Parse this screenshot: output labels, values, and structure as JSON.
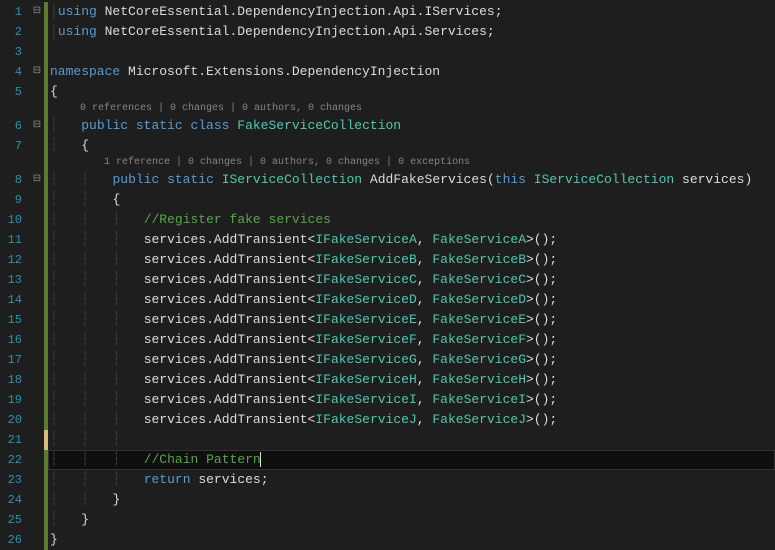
{
  "lineNumbers": [
    "1",
    "2",
    "3",
    "4",
    "5",
    "",
    "6",
    "7",
    "",
    "8",
    "9",
    "10",
    "11",
    "12",
    "13",
    "14",
    "15",
    "16",
    "17",
    "18",
    "19",
    "20",
    "21",
    "22",
    "23",
    "24",
    "25",
    "26"
  ],
  "folds": [
    "⊟",
    "",
    "",
    "⊟",
    "",
    "",
    "⊟",
    "",
    "",
    "⊟",
    "",
    "",
    "",
    "",
    "",
    "",
    "",
    "",
    "",
    "",
    "",
    "",
    "",
    "",
    "",
    "",
    "",
    ""
  ],
  "changes": [
    "green",
    "green",
    "green",
    "green",
    "green",
    "green",
    "green",
    "green",
    "green",
    "green",
    "green",
    "green",
    "green",
    "green",
    "green",
    "green",
    "green",
    "green",
    "green",
    "green",
    "green",
    "green",
    "yellow",
    "green",
    "green",
    "green",
    "green",
    "green"
  ],
  "codelensClass": "0 references | 0 changes | 0 authors, 0 changes",
  "codelensMethod": "1 reference | 0 changes | 0 authors, 0 changes | 0 exceptions",
  "using1_kw": "using",
  "using1_ns": " NetCoreEssential.DependencyInjection.Api.IServices;",
  "using2_kw": "using",
  "using2_ns": " NetCoreEssential.DependencyInjection.Api.Services;",
  "ns_kw": "namespace",
  "ns_name": " Microsoft.Extensions.DependencyInjection",
  "obrace": "{",
  "cbrace": "}",
  "class_mods": "public static class ",
  "class_name": "FakeServiceCollection",
  "method_mods": "public static ",
  "method_ret": "IServiceCollection",
  "method_name": " AddFakeServices",
  "method_open": "(",
  "method_this": "this ",
  "method_ptype": "IServiceCollection",
  "method_pname": " services",
  "method_close": ")",
  "comment_register": "//Register fake services",
  "svc_prefix": "services.AddTransient<",
  "svc_sep": ", ",
  "svc_suffix": ">();",
  "reg": [
    {
      "i": "IFakeServiceA",
      "c": "FakeServiceA"
    },
    {
      "i": "IFakeServiceB",
      "c": "FakeServiceB"
    },
    {
      "i": "IFakeServiceC",
      "c": "FakeServiceC"
    },
    {
      "i": "IFakeServiceD",
      "c": "FakeServiceD"
    },
    {
      "i": "IFakeServiceE",
      "c": "FakeServiceE"
    },
    {
      "i": "IFakeServiceF",
      "c": "FakeServiceF"
    },
    {
      "i": "IFakeServiceG",
      "c": "FakeServiceG"
    },
    {
      "i": "IFakeServiceH",
      "c": "FakeServiceH"
    },
    {
      "i": "IFakeServiceI",
      "c": "FakeServiceI"
    },
    {
      "i": "IFakeServiceJ",
      "c": "FakeServiceJ"
    }
  ],
  "comment_chain": "//Chain Pattern",
  "return_kw": "return",
  "return_id": " services;"
}
